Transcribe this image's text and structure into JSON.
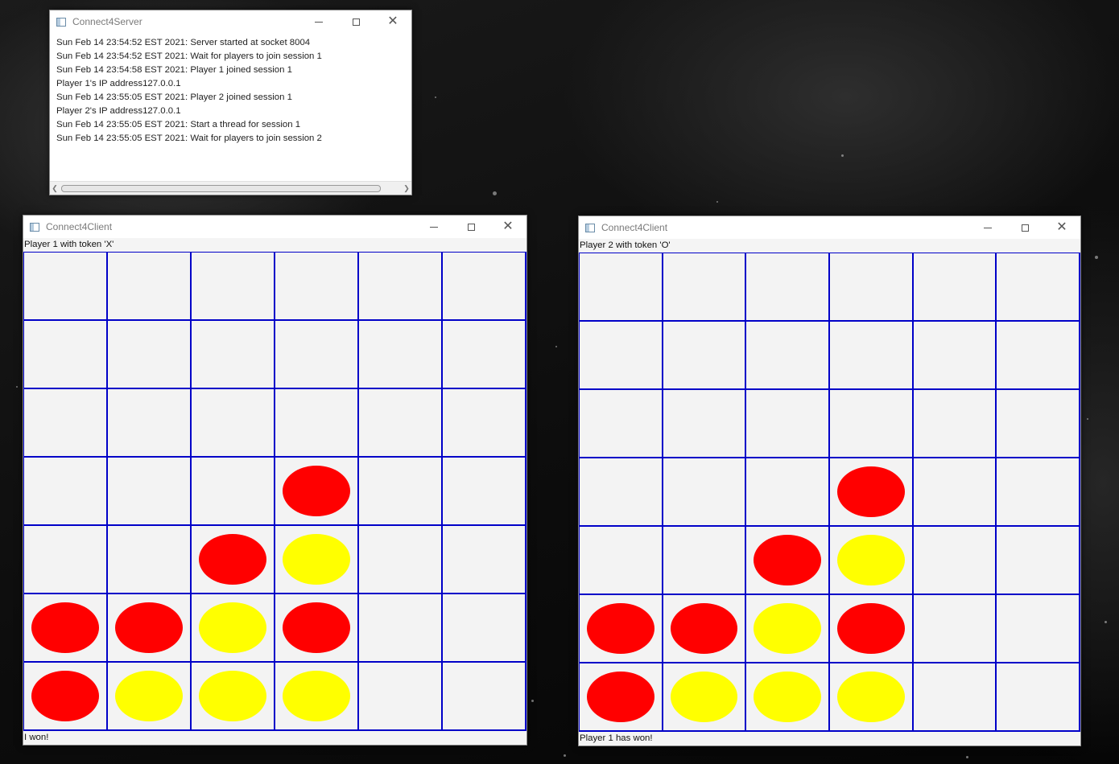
{
  "server": {
    "title": "Connect4Server",
    "log": [
      "Sun Feb 14 23:54:52 EST 2021: Server started at socket 8004",
      "Sun Feb 14 23:54:52 EST 2021: Wait for players to join session 1",
      "Sun Feb 14 23:54:58 EST 2021: Player 1 joined session 1",
      "Player 1's IP address127.0.0.1",
      "Sun Feb 14 23:55:05 EST 2021: Player 2 joined session 1",
      "Player 2's IP address127.0.0.1",
      "Sun Feb 14 23:55:05 EST 2021: Start a thread for session 1",
      "Sun Feb 14 23:55:05 EST 2021: Wait for players to join session 2"
    ]
  },
  "colors": {
    "red_token": "#ff0000",
    "yellow_token": "#ffff00",
    "grid_line": "#0000c8"
  },
  "board_state": [
    [
      "",
      "",
      "",
      "",
      "",
      ""
    ],
    [
      "",
      "",
      "",
      "",
      "",
      ""
    ],
    [
      "",
      "",
      "",
      "",
      "",
      ""
    ],
    [
      "",
      "",
      "",
      "R",
      "",
      ""
    ],
    [
      "",
      "",
      "R",
      "Y",
      "",
      ""
    ],
    [
      "R",
      "R",
      "Y",
      "R",
      "",
      ""
    ],
    [
      "R",
      "Y",
      "Y",
      "Y",
      "",
      ""
    ]
  ],
  "client1": {
    "title": "Connect4Client",
    "player_label": "Player 1 with token 'X'",
    "status": "I won!"
  },
  "client2": {
    "title": "Connect4Client",
    "player_label": "Player 2 with token 'O'",
    "status": "Player 1 has won!"
  }
}
